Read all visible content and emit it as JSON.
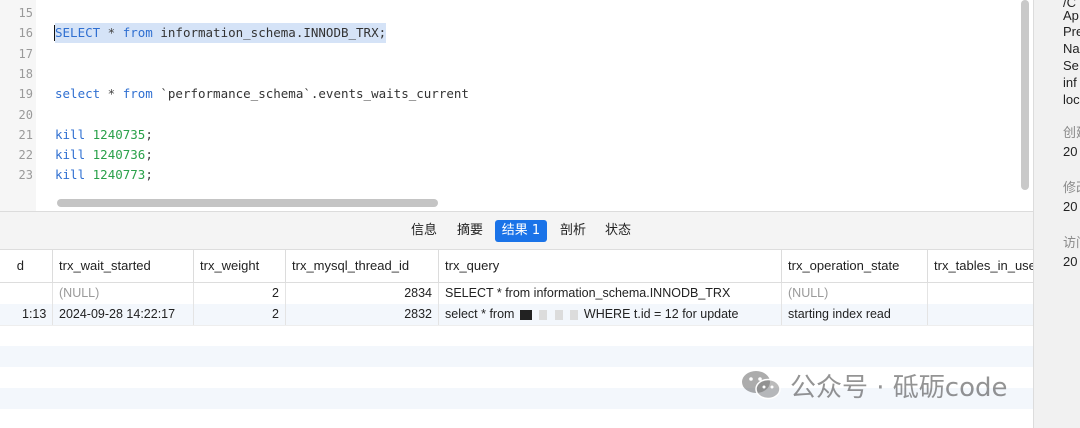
{
  "editor": {
    "lines": [
      {
        "n": "15",
        "parts": []
      },
      {
        "n": "16",
        "highlighted": true,
        "parts": [
          {
            "t": "SELECT",
            "c": "kw"
          },
          {
            "t": " * ",
            "c": "op"
          },
          {
            "t": "from",
            "c": "kw"
          },
          {
            "t": " information_schema.INNODB_TRX;",
            "c": "str"
          }
        ]
      },
      {
        "n": "17",
        "parts": []
      },
      {
        "n": "18",
        "parts": []
      },
      {
        "n": "19",
        "parts": [
          {
            "t": "select",
            "c": "kw"
          },
          {
            "t": " * ",
            "c": "op"
          },
          {
            "t": "from",
            "c": "kw"
          },
          {
            "t": " `performance_schema`.events_waits_current",
            "c": "str"
          }
        ]
      },
      {
        "n": "20",
        "parts": []
      },
      {
        "n": "21",
        "parts": [
          {
            "t": "kill",
            "c": "kw"
          },
          {
            "t": " ",
            "c": "op"
          },
          {
            "t": "1240735",
            "c": "num"
          },
          {
            "t": ";",
            "c": "op"
          }
        ]
      },
      {
        "n": "22",
        "parts": [
          {
            "t": "kill",
            "c": "kw"
          },
          {
            "t": " ",
            "c": "op"
          },
          {
            "t": "1240736",
            "c": "num"
          },
          {
            "t": ";",
            "c": "op"
          }
        ]
      },
      {
        "n": "23",
        "parts": [
          {
            "t": "kill",
            "c": "kw"
          },
          {
            "t": " ",
            "c": "op"
          },
          {
            "t": "1240773",
            "c": "num"
          },
          {
            "t": ";",
            "c": "op"
          }
        ]
      }
    ]
  },
  "tabs": [
    {
      "label": "信息",
      "active": false
    },
    {
      "label": "摘要",
      "active": false
    },
    {
      "label": "结果 1",
      "active": true
    },
    {
      "label": "剖析",
      "active": false
    },
    {
      "label": "状态",
      "active": false
    }
  ],
  "grid": {
    "columns": [
      "d",
      "trx_wait_started",
      "trx_weight",
      "trx_mysql_thread_id",
      "trx_query",
      "trx_operation_state",
      "trx_tables_in_use"
    ],
    "rows": [
      {
        "c0": "",
        "c1": "(NULL)",
        "c2": "2",
        "c3": "2834",
        "c4": "SELECT * from information_schema.INNODB_TRX",
        "c4_redacted": false,
        "c5": "(NULL)",
        "c6": ""
      },
      {
        "c0": "1:13",
        "c1": "2024-09-28 14:22:17",
        "c2": "2",
        "c3": "2832",
        "c4_prefix": "select * from",
        "c4_suffix": "WHERE t.id = 12 for update",
        "c4_redacted": true,
        "c5": "starting index read",
        "c6": ""
      }
    ]
  },
  "side_panel": {
    "lines": [
      "/C",
      "Ap",
      "Pre",
      "Na",
      "Se",
      "inf",
      "loc"
    ],
    "sections": [
      {
        "label": "创建",
        "value": "20"
      },
      {
        "label": "修改",
        "value": "20"
      },
      {
        "label": "访问",
        "value": "20"
      }
    ]
  },
  "watermark": {
    "text": "公众号 · 砥砺code",
    "icon": "wechat-icon"
  },
  "colors": {
    "keyword": "#2f6fd1",
    "number": "#2aa14a",
    "active_tab": "#1a73e8",
    "selection": "#d5e3f7"
  }
}
